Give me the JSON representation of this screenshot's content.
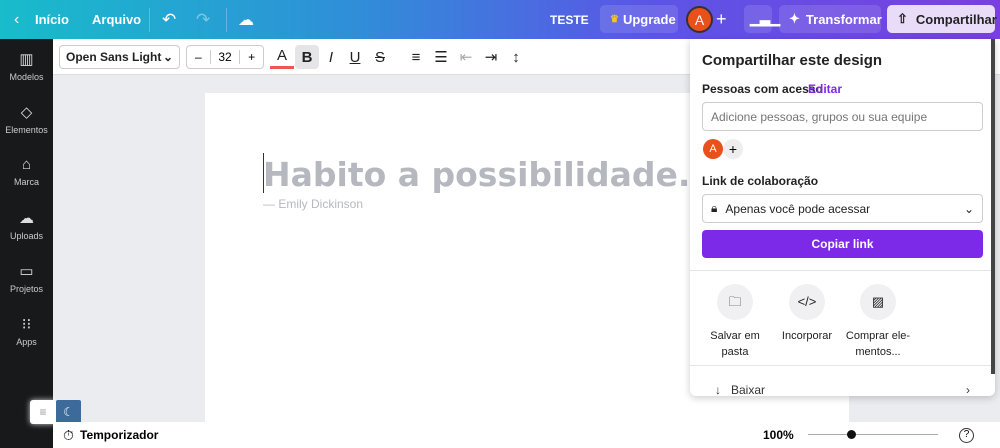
{
  "topbar": {
    "back": "Início",
    "file": "Arquivo",
    "title": "TESTE",
    "upgrade": "Upgrade",
    "avatar": "A",
    "transform": "Transformar",
    "share": "Compartilhar"
  },
  "toolbar": {
    "font": "Open Sans Light",
    "size": "32",
    "minus": "–",
    "plus": "+"
  },
  "sidebar": [
    {
      "label": "Modelos",
      "icon": "▥"
    },
    {
      "label": "Elementos",
      "icon": "◇"
    },
    {
      "label": "Marca",
      "icon": "⌂"
    },
    {
      "label": "Uploads",
      "icon": "☁"
    },
    {
      "label": "Projetos",
      "icon": "▭"
    },
    {
      "label": "Apps",
      "icon": "⁝⁝"
    }
  ],
  "canvas": {
    "quote": "Habito a possibilidade.",
    "author": "— Emily Dickinson"
  },
  "share_panel": {
    "title": "Compartilhar este design",
    "people_label": "Pessoas com acesso",
    "edit": "Editar",
    "input_placeholder": "Adicione pessoas, grupos ou sua equipe",
    "avatar": "A",
    "link_label": "Link de colaboração",
    "access": "Apenas você pode acessar",
    "copy": "Copiar link",
    "actions": [
      {
        "label": "Salvar em pasta"
      },
      {
        "label": "Incorporar"
      },
      {
        "label": "Comprar ele-mentos..."
      }
    ],
    "download": "Baixar"
  },
  "bottom": {
    "timer": "Temporizador",
    "zoom": "100%",
    "zoom_fraction": 0.33
  }
}
